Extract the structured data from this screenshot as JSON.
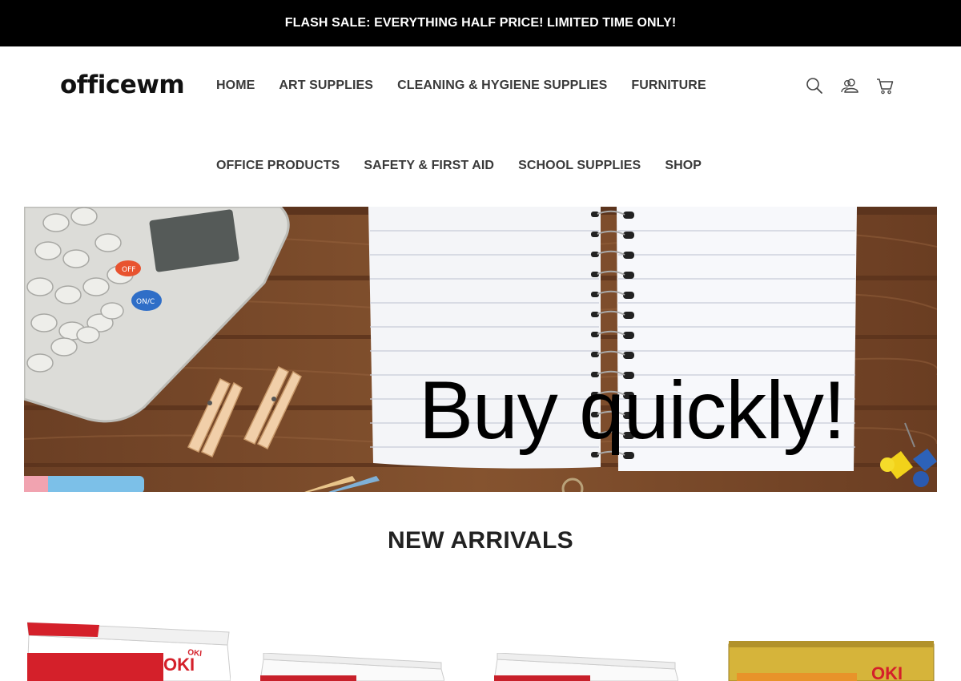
{
  "announcement": "FLASH SALE: EVERYTHING HALF PRICE! LIMITED TIME ONLY!",
  "logo": "officewm",
  "nav": {
    "row1": [
      "HOME",
      "ART SUPPLIES",
      "CLEANING & HYGIENE SUPPLIES",
      "FURNITURE"
    ],
    "row2": [
      "OFFICE PRODUCTS",
      "SAFETY & FIRST AID",
      "SCHOOL SUPPLIES",
      "SHOP"
    ]
  },
  "header_icons": [
    "search-icon",
    "account-icon",
    "cart-icon"
  ],
  "hero": {
    "headline": "Buy quickly!",
    "calculator_keys": {
      "off": "OFF",
      "on_clear": "ON/C"
    }
  },
  "sections": {
    "new_arrivals": "NEW ARRIVALS"
  },
  "products": [
    {
      "brand": "OKI",
      "box_color": "#d4202a"
    },
    {
      "brand": "",
      "box_color": "#c8202a"
    },
    {
      "brand": "",
      "box_color": "#c8202a"
    },
    {
      "brand": "OKI",
      "box_color": "#d6b43a"
    }
  ],
  "colors": {
    "announcement_bg": "#000000",
    "nav_text": "#3a3a3a",
    "wood": "#7a4a2c",
    "accent_red": "#d4202a"
  }
}
